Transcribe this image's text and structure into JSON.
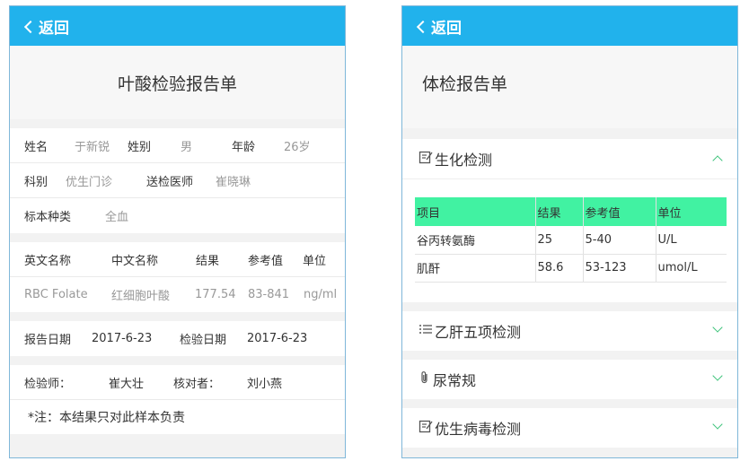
{
  "left": {
    "back_label": "返回",
    "title": "叶酸检验报告单",
    "info": {
      "name_label": "姓名",
      "name_value": "于新锐",
      "gender_label": "姓别",
      "gender_value": "男",
      "age_label": "年龄",
      "age_value": "26岁",
      "dept_label": "科别",
      "dept_value": "优生门诊",
      "doctor_label": "送检医师",
      "doctor_value": "崔晓琳",
      "specimen_label": "标本种类",
      "specimen_value": "全血"
    },
    "results": {
      "headers": [
        "英文名称",
        "中文名称",
        "结果",
        "参考值",
        "单位"
      ],
      "row": [
        "RBC Folate",
        "红细胞叶酸",
        "177.54",
        "83-841",
        "ng/ml"
      ]
    },
    "dates": {
      "report_label": "报告日期",
      "report_value": "2017-6-23",
      "test_label": "检验日期",
      "test_value": "2017-6-23"
    },
    "staff": {
      "tester_label": "检验师：",
      "tester_value": "崔大壮",
      "checker_label": "核对者：",
      "checker_value": "刘小燕"
    },
    "note": "*注：本结果只对此样本负责"
  },
  "right": {
    "back_label": "返回",
    "title": "体检报告单",
    "sections": [
      {
        "label": "生化检测",
        "icon": "edit-icon",
        "expanded": true
      },
      {
        "label": "乙肝五项检测",
        "icon": "list-icon",
        "expanded": false
      },
      {
        "label": "尿常规",
        "icon": "paperclip-icon",
        "expanded": false
      },
      {
        "label": "优生病毒检测",
        "icon": "edit-icon",
        "expanded": false
      }
    ],
    "table": {
      "headers": [
        "项目",
        "结果",
        "参考值",
        "单位"
      ],
      "rows": [
        [
          "谷丙转氨酶",
          "25",
          "5-40",
          "U/L"
        ],
        [
          "肌酐",
          "58.6",
          "53-123",
          "umol/L"
        ]
      ]
    }
  },
  "colors": {
    "header": "#21b2ec",
    "table_header": "#41f2a2",
    "accent_arrow": "#3fc47c"
  }
}
